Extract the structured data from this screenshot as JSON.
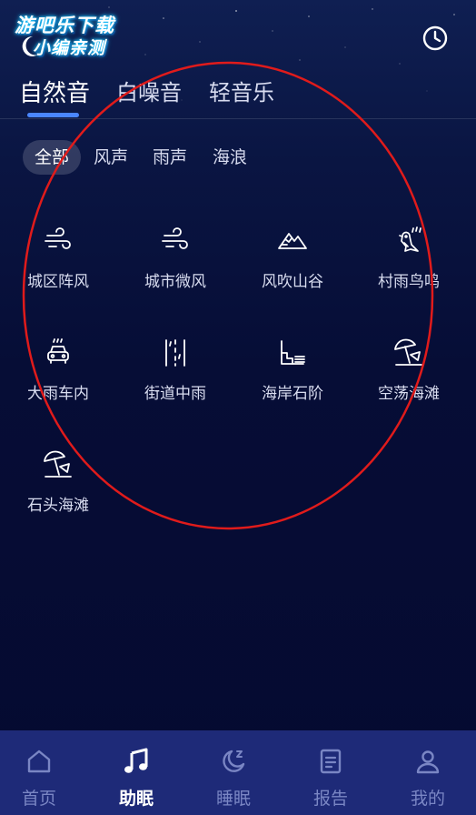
{
  "watermark": {
    "line1": "游吧乐下载",
    "line2": "小编亲测"
  },
  "tabs": [
    {
      "label": "自然音",
      "active": true
    },
    {
      "label": "白噪音",
      "active": false
    },
    {
      "label": "轻音乐",
      "active": false
    }
  ],
  "filters": [
    {
      "label": "全部",
      "active": true
    },
    {
      "label": "风声",
      "active": false
    },
    {
      "label": "雨声",
      "active": false
    },
    {
      "label": "海浪",
      "active": false
    }
  ],
  "sounds": [
    {
      "label": "城区阵风",
      "icon": "wind-icon"
    },
    {
      "label": "城市微风",
      "icon": "breeze-icon"
    },
    {
      "label": "风吹山谷",
      "icon": "mountain-icon"
    },
    {
      "label": "村雨鸟鸣",
      "icon": "bird-rain-icon"
    },
    {
      "label": "大雨车内",
      "icon": "car-rain-icon"
    },
    {
      "label": "街道中雨",
      "icon": "street-rain-icon"
    },
    {
      "label": "海岸石阶",
      "icon": "stairs-icon"
    },
    {
      "label": "空荡海滩",
      "icon": "beach-umbrella-icon"
    },
    {
      "label": "石头海滩",
      "icon": "beach-umbrella-icon"
    }
  ],
  "nav": [
    {
      "label": "首页",
      "icon": "home-icon",
      "active": false
    },
    {
      "label": "助眠",
      "icon": "music-note-icon",
      "active": true
    },
    {
      "label": "睡眠",
      "icon": "moon-sleep-icon",
      "active": false
    },
    {
      "label": "报告",
      "icon": "report-icon",
      "active": false
    },
    {
      "label": "我的",
      "icon": "profile-icon",
      "active": false
    }
  ],
  "colors": {
    "accent": "#4a86ff",
    "annotation": "#e01b1b",
    "nav_background": "#1e2a78",
    "nav_inactive": "#7a86c4"
  }
}
